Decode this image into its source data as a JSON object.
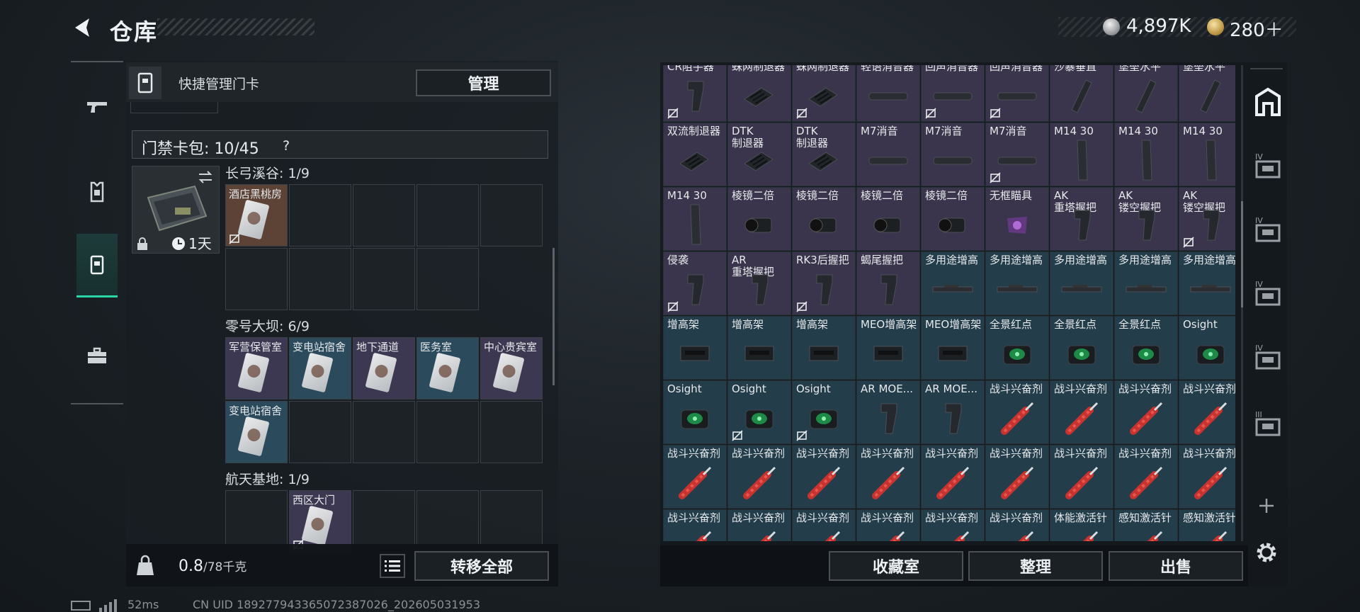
{
  "header": {
    "title": "仓库",
    "silver_amount": "4,897K",
    "gold_amount": "280＋"
  },
  "sidenav": {
    "items": [
      {
        "name": "weapons",
        "icon": "gun-icon"
      },
      {
        "name": "armor",
        "icon": "armor-icon"
      },
      {
        "name": "keycards",
        "icon": "keycard-icon",
        "active": true
      },
      {
        "name": "misc",
        "icon": "briefcase-icon"
      }
    ]
  },
  "keycard_panel": {
    "quick_label": "快捷管理门卡",
    "manage_label": "管理",
    "pack_label": "门禁卡包: 10/45",
    "pack_days": "1天",
    "sections": [
      {
        "label": "长弓溪谷: 1/9",
        "cards": [
          {
            "name": "酒店黑桃房",
            "color": "brown",
            "noshare": true
          }
        ]
      },
      {
        "label": "零号大坝: 6/9",
        "cards": [
          {
            "name": "军营保管室",
            "color": "purple"
          },
          {
            "name": "变电站宿舍",
            "color": "blue"
          },
          {
            "name": "地下通道",
            "color": "purple"
          },
          {
            "name": "医务室",
            "color": "blue"
          },
          {
            "name": "中心贵宾室",
            "color": "purple"
          },
          {
            "name": "变电站宿舍",
            "color": "blue"
          }
        ]
      },
      {
        "label": "航天基地: 1/9",
        "cards": [
          {
            "name": "西区大门",
            "color": "purple",
            "noshare": true
          }
        ]
      }
    ],
    "weight_value": "0.8",
    "weight_max": "/78千克",
    "transfer_label": "转移全部"
  },
  "status": {
    "ping": "52ms",
    "uid": "CN UID 1892779433650723870​26_202605031953"
  },
  "inventory": {
    "rows": [
      [
        {
          "name": "CR阻手器",
          "c": "p",
          "icon": "grip",
          "ns": true
        },
        {
          "name": "蛛网制退器",
          "c": "p",
          "icon": "muzzle"
        },
        {
          "name": "蛛网制退器",
          "c": "p",
          "icon": "muzzle",
          "ns": true
        },
        {
          "name": "轻语消音器",
          "c": "p",
          "icon": "silencer"
        },
        {
          "name": "回声消音器",
          "c": "p",
          "icon": "silencer",
          "ns": true
        },
        {
          "name": "回声消音器",
          "c": "p",
          "icon": "silencer",
          "ns": true
        },
        {
          "name": "沙暴垂直",
          "c": "p",
          "icon": "vgrip"
        },
        {
          "name": "堡垒水平",
          "c": "p",
          "icon": "vgrip"
        },
        {
          "name": "堡垒水平",
          "c": "p",
          "icon": "vgrip"
        }
      ],
      [
        {
          "name": "双流制退器",
          "c": "p",
          "icon": "muzzle"
        },
        {
          "name": "DTK\n制退器",
          "c": "p",
          "icon": "muzzle"
        },
        {
          "name": "DTK\n制退器",
          "c": "p",
          "icon": "muzzle"
        },
        {
          "name": "M7消音",
          "c": "p",
          "icon": "silencer"
        },
        {
          "name": "M7消音",
          "c": "p",
          "icon": "silencer"
        },
        {
          "name": "M7消音",
          "c": "p",
          "icon": "silencer",
          "ns": true
        },
        {
          "name": "M14 30",
          "c": "p",
          "icon": "mag"
        },
        {
          "name": "M14 30",
          "c": "p",
          "icon": "mag"
        },
        {
          "name": "M14 30",
          "c": "p",
          "icon": "mag"
        }
      ],
      [
        {
          "name": "M14 30",
          "c": "p",
          "icon": "mag"
        },
        {
          "name": "棱镜二倍",
          "c": "p",
          "icon": "scope"
        },
        {
          "name": "棱镜二倍",
          "c": "p",
          "icon": "scope"
        },
        {
          "name": "棱镜二倍",
          "c": "p",
          "icon": "scope"
        },
        {
          "name": "棱镜二倍",
          "c": "p",
          "icon": "scope"
        },
        {
          "name": "无框瞄具",
          "c": "p",
          "icon": "reddot"
        },
        {
          "name": "AK\n重塔握把",
          "c": "p",
          "icon": "grip"
        },
        {
          "name": "AK\n镂空握把",
          "c": "p",
          "icon": "grip"
        },
        {
          "name": "AK\n镂空握把",
          "c": "p",
          "icon": "grip",
          "ns": true
        }
      ],
      [
        {
          "name": "侵袭",
          "c": "p",
          "icon": "grip",
          "ns": true
        },
        {
          "name": "AR\n重塔握把",
          "c": "p",
          "icon": "grip"
        },
        {
          "name": "RK3后握把",
          "c": "p",
          "icon": "grip",
          "ns": true
        },
        {
          "name": "蝎尾握把",
          "c": "p",
          "icon": "grip"
        },
        {
          "name": "多用途增高",
          "c": "b",
          "icon": "rail"
        },
        {
          "name": "多用途增高",
          "c": "b",
          "icon": "rail"
        },
        {
          "name": "多用途增高",
          "c": "b",
          "icon": "rail"
        },
        {
          "name": "多用途增高",
          "c": "b",
          "icon": "rail"
        },
        {
          "name": "多用途增高",
          "c": "b",
          "icon": "rail"
        }
      ],
      [
        {
          "name": "增高架",
          "c": "b",
          "icon": "riser"
        },
        {
          "name": "增高架",
          "c": "b",
          "icon": "riser"
        },
        {
          "name": "增高架",
          "c": "b",
          "icon": "riser"
        },
        {
          "name": "MEO增高架",
          "c": "b",
          "icon": "riser"
        },
        {
          "name": "MEO增高架",
          "c": "b",
          "icon": "riser"
        },
        {
          "name": "全景红点",
          "c": "b",
          "icon": "holo"
        },
        {
          "name": "全景红点",
          "c": "b",
          "icon": "holo"
        },
        {
          "name": "全景红点",
          "c": "b",
          "icon": "holo"
        },
        {
          "name": "Osight",
          "c": "b",
          "icon": "holo"
        }
      ],
      [
        {
          "name": "Osight",
          "c": "b",
          "icon": "holo"
        },
        {
          "name": "Osight",
          "c": "b",
          "icon": "holo",
          "ns": true
        },
        {
          "name": "Osight",
          "c": "b",
          "icon": "holo",
          "ns": true
        },
        {
          "name": "AR MOE...",
          "c": "b",
          "icon": "grip"
        },
        {
          "name": "AR MOE...",
          "c": "b",
          "icon": "grip"
        },
        {
          "name": "战斗兴奋剂",
          "c": "b",
          "icon": "syringe"
        },
        {
          "name": "战斗兴奋剂",
          "c": "b",
          "icon": "syringe"
        },
        {
          "name": "战斗兴奋剂",
          "c": "b",
          "icon": "syringe"
        },
        {
          "name": "战斗兴奋剂",
          "c": "b",
          "icon": "syringe"
        }
      ],
      [
        {
          "name": "战斗兴奋剂",
          "c": "b",
          "icon": "syringe"
        },
        {
          "name": "战斗兴奋剂",
          "c": "b",
          "icon": "syringe"
        },
        {
          "name": "战斗兴奋剂",
          "c": "b",
          "icon": "syringe"
        },
        {
          "name": "战斗兴奋剂",
          "c": "b",
          "icon": "syringe"
        },
        {
          "name": "战斗兴奋剂",
          "c": "b",
          "icon": "syringe"
        },
        {
          "name": "战斗兴奋剂",
          "c": "b",
          "icon": "syringe"
        },
        {
          "name": "战斗兴奋剂",
          "c": "b",
          "icon": "syringe"
        },
        {
          "name": "战斗兴奋剂",
          "c": "b",
          "icon": "syringe"
        },
        {
          "name": "战斗兴奋剂",
          "c": "b",
          "icon": "syringe"
        }
      ],
      [
        {
          "name": "战斗兴奋剂",
          "c": "b",
          "icon": "syringe"
        },
        {
          "name": "战斗兴奋剂",
          "c": "b",
          "icon": "syringe"
        },
        {
          "name": "战斗兴奋剂",
          "c": "b",
          "icon": "syringe"
        },
        {
          "name": "战斗兴奋剂",
          "c": "b",
          "icon": "syringe"
        },
        {
          "name": "战斗兴奋剂",
          "c": "b",
          "icon": "syringe"
        },
        {
          "name": "战斗兴奋剂",
          "c": "b",
          "icon": "syringe"
        },
        {
          "name": "体能激活针",
          "c": "b",
          "icon": "syringe"
        },
        {
          "name": "感知激活针",
          "c": "b",
          "icon": "syringe"
        },
        {
          "name": "感知激活针",
          "c": "b",
          "icon": "syringe"
        }
      ]
    ],
    "collect_label": "收藏室",
    "sort_label": "整理",
    "sell_label": "出售"
  },
  "right_rail": {
    "items": [
      {
        "name": "vault",
        "icon": "vault-icon"
      },
      {
        "name": "case-4-a",
        "icon": "case-icon",
        "tier": "IV"
      },
      {
        "name": "case-4-b",
        "icon": "case-icon",
        "tier": "IV"
      },
      {
        "name": "case-4-c",
        "icon": "case-icon",
        "tier": "IV"
      },
      {
        "name": "case-4-d",
        "icon": "case-icon",
        "tier": "IV"
      },
      {
        "name": "case-3",
        "icon": "case-icon",
        "tier": "III"
      }
    ]
  },
  "colors": {
    "accent": "#2ad6a6",
    "purple_rarity": "#3a354c",
    "blue_rarity": "#243d4b",
    "brown_rarity": "#5c4336"
  }
}
